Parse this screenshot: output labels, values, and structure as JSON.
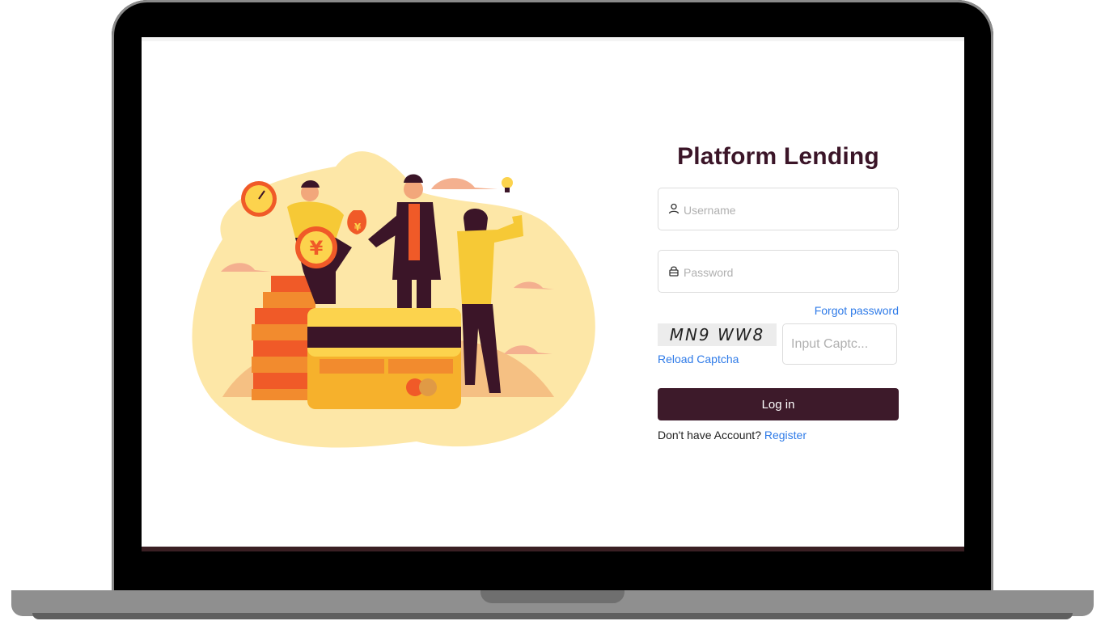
{
  "app": {
    "title": "Platform Lending"
  },
  "form": {
    "username_placeholder": "Username",
    "password_placeholder": "Password",
    "forgot_password_label": "Forgot password",
    "captcha_text": "MN9 WW8",
    "reload_captcha_label": "Reload Captcha",
    "captcha_input_placeholder": "Input Captc...",
    "login_label": "Log in",
    "register_prompt": "Don't have Account?",
    "register_label": "Register"
  },
  "colors": {
    "brand": "#3d1a2a",
    "link": "#2f7be8",
    "accent_yellow": "#f6c936"
  }
}
